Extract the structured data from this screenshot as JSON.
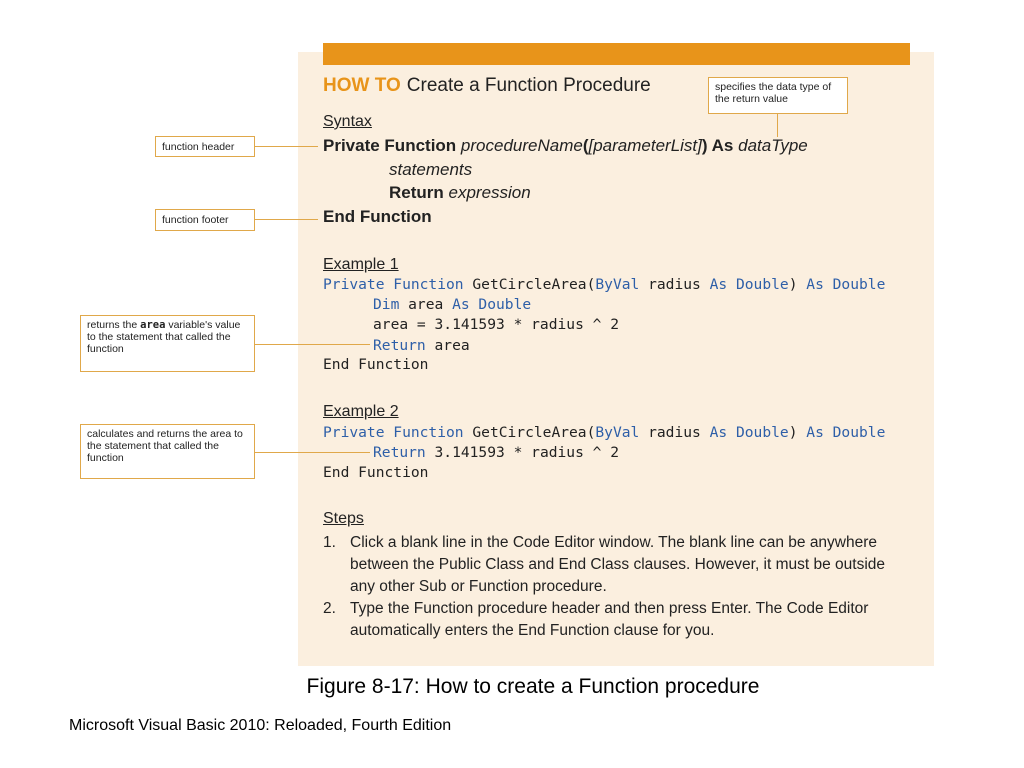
{
  "how_to": {
    "label": "HOW TO",
    "title": "Create a Function Procedure"
  },
  "syntax": {
    "heading": "Syntax",
    "header_private_function": "Private Function ",
    "header_procedure_name": "procedureName",
    "header_paren_open": "(",
    "header_param_list": "[parameterList]",
    "header_paren_close_as": ") As ",
    "header_data_type": "dataType",
    "statements": "statements",
    "return_kw": "Return ",
    "return_expr": "expression",
    "end": "End Function"
  },
  "example1": {
    "heading": "Example 1",
    "l1_kw1": "Private Function ",
    "l1_name": "GetCircleArea(",
    "l1_kw2": "ByVal",
    "l1_param": " radius ",
    "l1_kw3": "As Double",
    "l1_close": ") ",
    "l1_kw4": "As Double",
    "l2_kw": "Dim",
    "l2_var": " area ",
    "l2_kw2": "As Double",
    "l3": "area = 3.141593 * radius ^ 2",
    "l4_kw": "Return",
    "l4_var": " area",
    "l5": "End Function"
  },
  "example2": {
    "heading": "Example 2",
    "l1_kw1": "Private Function ",
    "l1_name": "GetCircleArea(",
    "l1_kw2": "ByVal",
    "l1_param": " radius ",
    "l1_kw3": "As Double",
    "l1_close": ") ",
    "l1_kw4": "As Double",
    "l2_kw": "Return",
    "l2_rest": " 3.141593 * radius ^ 2",
    "l3": "End Function"
  },
  "callouts": {
    "data_type": "specifies the data type of the return value",
    "function_header": "function header",
    "function_footer": "function footer",
    "returns_pre": "returns the ",
    "returns_code": "area",
    "returns_post": " variable's value to the statement that called the function",
    "calculates": "calculates and returns the area to the statement that called the function"
  },
  "steps": {
    "heading": "Steps",
    "items": [
      {
        "num": "1.",
        "text": "Click a blank line in the Code Editor window. The blank line can be anywhere between the Public Class and End Class clauses. However, it must be outside any other Sub or Function procedure."
      },
      {
        "num": "2.",
        "text": "Type the Function procedure header and then press Enter. The Code Editor automatically enters the End Function clause for you."
      }
    ]
  },
  "caption": "Figure 8-17: How to create a Function procedure",
  "footer": "Microsoft Visual Basic 2010: Reloaded, Fourth Edition"
}
